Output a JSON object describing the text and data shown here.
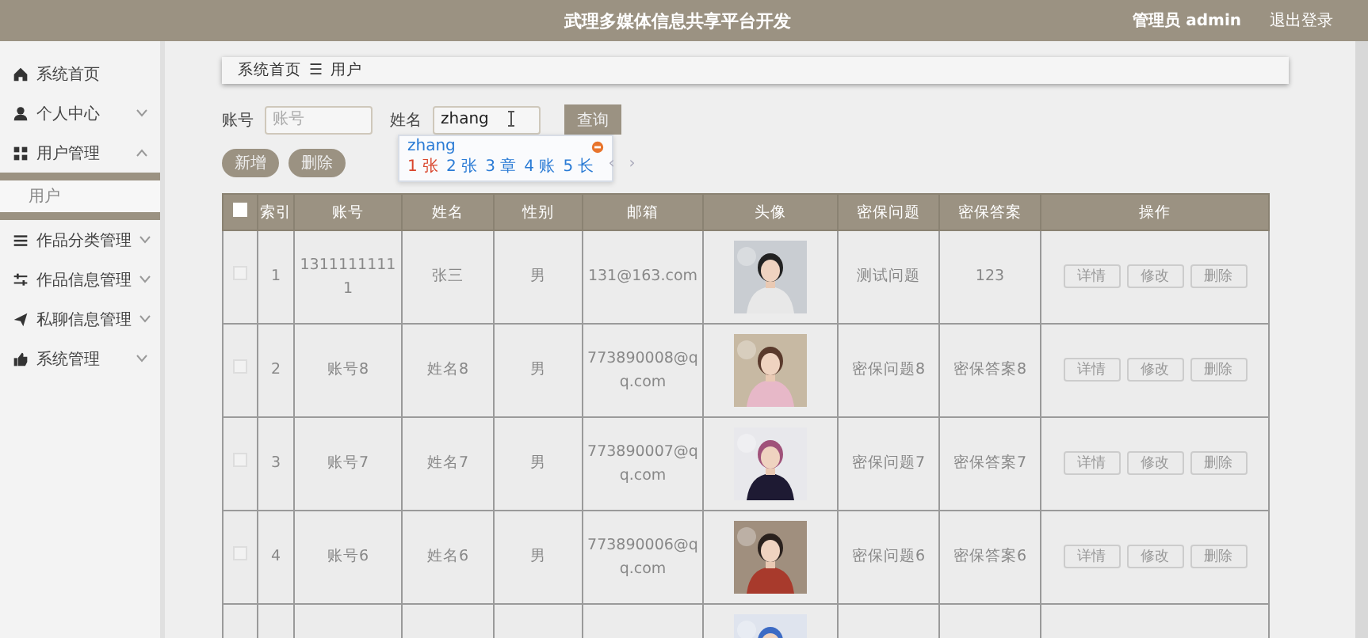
{
  "header": {
    "title": "武理多媒体信息共享平台开发",
    "user": "管理员 admin",
    "logout": "退出登录"
  },
  "sidebar": {
    "items": [
      {
        "label": "系统首页"
      },
      {
        "label": "个人中心",
        "expanded": false
      },
      {
        "label": "用户管理",
        "expanded": true,
        "children": [
          {
            "label": "用户",
            "selected": true
          }
        ]
      },
      {
        "label": "作品分类管理",
        "expanded": false
      },
      {
        "label": "作品信息管理",
        "expanded": false
      },
      {
        "label": "私聊信息管理",
        "expanded": false
      },
      {
        "label": "系统管理",
        "expanded": false
      }
    ]
  },
  "breadcrumb": {
    "items": [
      "系统首页",
      "用户"
    ],
    "separator": "☰"
  },
  "search": {
    "fields": [
      {
        "label": "账号",
        "placeholder": "账号"
      },
      {
        "label": "姓名",
        "value": "zhang"
      }
    ],
    "button": "查询"
  },
  "ime": {
    "input": "zhang",
    "candidates": [
      {
        "index": "1",
        "text": "张",
        "selected": true
      },
      {
        "index": "2",
        "text": "张",
        "selected": false
      },
      {
        "index": "3",
        "text": "章",
        "selected": false
      },
      {
        "index": "4",
        "text": "账",
        "selected": false
      },
      {
        "index": "5",
        "text": "长",
        "selected": false
      }
    ],
    "prev": "‹",
    "next": "›"
  },
  "actions": [
    "新增",
    "删除"
  ],
  "table": {
    "header_checked": false,
    "columns": [
      "索引",
      "账号",
      "姓名",
      "性别",
      "邮箱",
      "头像",
      "密保问题",
      "密保答案",
      "操作"
    ],
    "rows": [
      {
        "checked": false,
        "index": "1",
        "account": "13111111111",
        "name": "张三",
        "gender": "男",
        "email": "131@163.com",
        "avatar": {
          "kind": "picture"
        },
        "question": "测试问题",
        "answer": "123",
        "buttons": [
          "详情",
          "修改",
          "删除"
        ]
      },
      {
        "checked": false,
        "index": "2",
        "account": "账号8",
        "name": "姓名8",
        "gender": "男",
        "email": "773890008@qq.com",
        "avatar": {
          "kind": "picture"
        },
        "question": "密保问题8",
        "answer": "密保答案8",
        "buttons": [
          "详情",
          "修改",
          "删除"
        ]
      },
      {
        "checked": false,
        "index": "3",
        "account": "账号7",
        "name": "姓名7",
        "gender": "男",
        "email": "773890007@qq.com",
        "avatar": {
          "kind": "picture"
        },
        "question": "密保问题7",
        "answer": "密保答案7",
        "buttons": [
          "详情",
          "修改",
          "删除"
        ]
      },
      {
        "checked": false,
        "index": "4",
        "account": "账号6",
        "name": "姓名6",
        "gender": "男",
        "email": "773890006@qq.com",
        "avatar": {
          "kind": "picture"
        },
        "question": "密保问题6",
        "answer": "密保答案6",
        "buttons": [
          "详情",
          "修改",
          "删除"
        ]
      },
      {
        "avatar": {
          "kind": "picture"
        }
      }
    ]
  }
}
